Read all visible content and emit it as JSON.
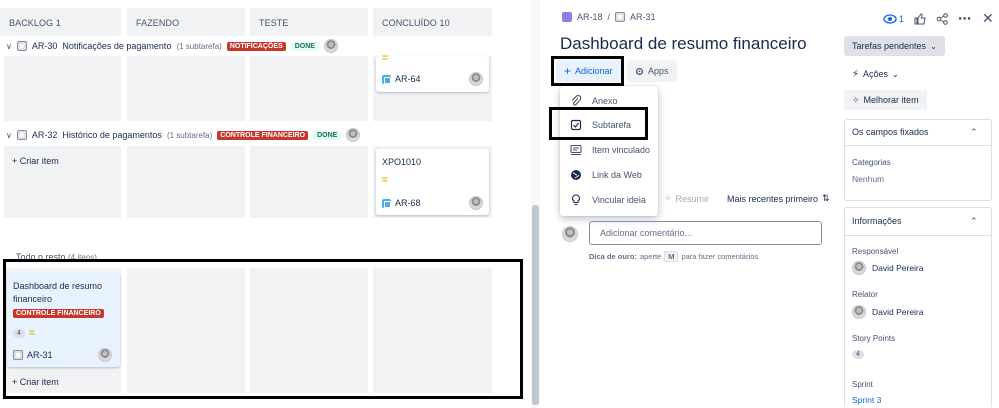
{
  "board": {
    "columns": [
      {
        "label": "BACKLOG 1"
      },
      {
        "label": "FAZENDO"
      },
      {
        "label": "TESTE"
      },
      {
        "label": "CONCLUÍDO 10"
      }
    ],
    "swimlanes": [
      {
        "key": "AR-30",
        "title": "Notificações de pagamento",
        "subtasks": "(1 subtarefa)",
        "label": "NOTIFICAÇÕES",
        "status": "DONE"
      },
      {
        "key": "AR-32",
        "title": "Histórico de pagamentos",
        "subtasks": "(1 subtarefa)",
        "label": "CONTROLE FINANCEIRO",
        "status": "DONE"
      }
    ],
    "lane1_card": {
      "key": "AR-64",
      "priority": "="
    },
    "lane2_card": {
      "title": "XPO1010",
      "key": "AR-68",
      "priority": "="
    },
    "lane3_header": "Todo o resto",
    "lane3_header_count": "(4 itens)",
    "selected_card": {
      "title": "Dashboard de resumo financeiro",
      "label": "CONTROLE FINANCEIRO",
      "points": "4",
      "priority": "=",
      "key": "AR-31"
    },
    "create_item": "Criar item"
  },
  "detail": {
    "breadcrumb_epic": "AR-18",
    "breadcrumb_sep": "/",
    "breadcrumb_issue": "AR-31",
    "watchers": "1",
    "title": "Dashboard de resumo financeiro",
    "add_button": "Adicionar",
    "apps_button": "Apps",
    "add_menu": [
      {
        "label": "Anexo",
        "icon": "paperclip-icon"
      },
      {
        "label": "Subtarefa",
        "icon": "subtask-icon"
      },
      {
        "label": "Item vinculado",
        "icon": "linked-item-icon"
      },
      {
        "label": "Link da Web",
        "icon": "globe-icon"
      },
      {
        "label": "Vincular ideia",
        "icon": "lightbulb-icon"
      }
    ],
    "summarize": "Resumir",
    "sort": "Mais recentes primeiro",
    "comment_placeholder": "Adicionar comentário...",
    "tip_prefix": "Dica de ouro:",
    "tip_mid": "aperte",
    "tip_key": "M",
    "tip_suffix": "para fazer comentários",
    "status_button": "Tarefas pendentes",
    "actions": "Ações",
    "improve": "Melhorar item",
    "pinned_fields_title": "Os campos fixados",
    "categories_label": "Categorias",
    "categories_value": "Nenhum",
    "info_title": "Informações",
    "assignee_label": "Responsável",
    "assignee_value": "David Pereira",
    "reporter_label": "Relator",
    "reporter_value": "David Pereira",
    "story_points_label": "Story Points",
    "story_points_value": "4",
    "sprint_label": "Sprint",
    "sprint_value": "Sprint 3"
  },
  "colors": {
    "accent": "#0c66e4",
    "lozenge_red": "#c9372c",
    "done_green": "#216e4e",
    "epic_purple": "#8f7ee7"
  }
}
